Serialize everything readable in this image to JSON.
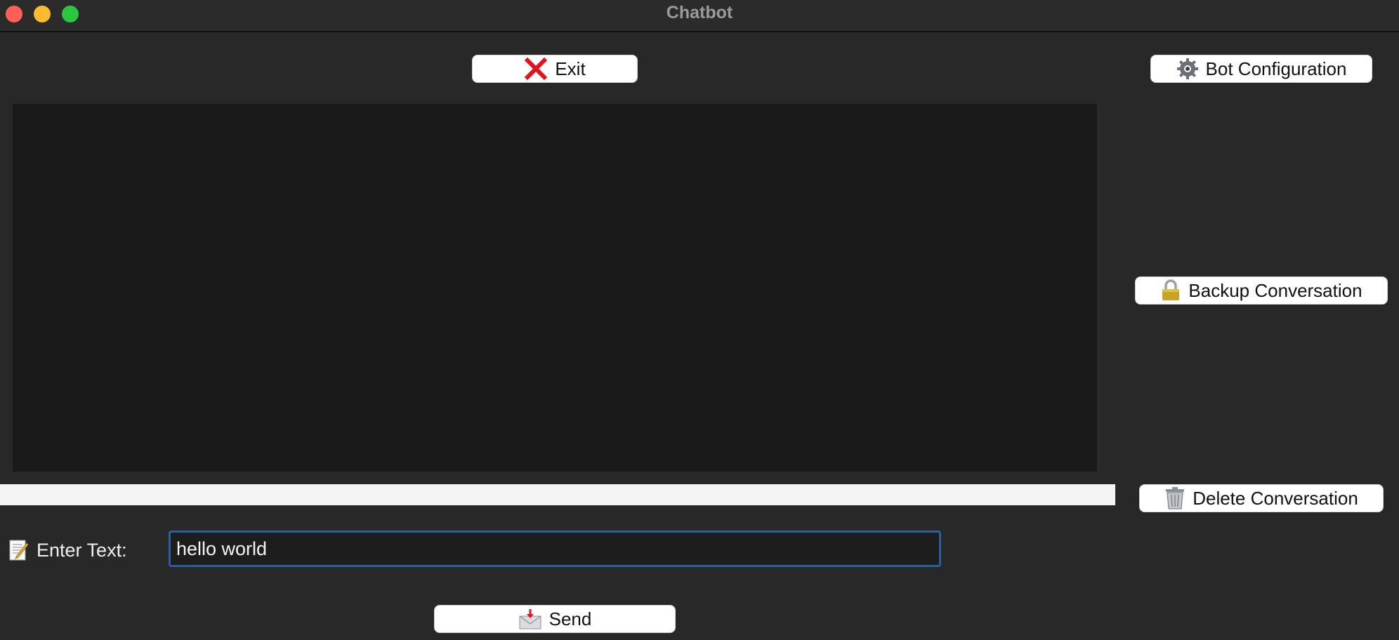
{
  "window": {
    "title": "Chatbot"
  },
  "toolbar": {
    "exit_label": "Exit",
    "bot_config_label": "Bot Configuration",
    "backup_label": "Backup Conversation",
    "delete_label": "Delete Conversation",
    "send_label": "Send"
  },
  "input": {
    "label": "Enter Text:",
    "value": "hello world"
  },
  "icons": {
    "exit": "close-x-icon",
    "bot_config": "gear-icon",
    "backup": "lock-icon",
    "delete": "trash-icon",
    "enter_text": "memo-icon",
    "send": "envelope-icon"
  },
  "colors": {
    "background": "#282828",
    "chat_area": "#1a1a1a",
    "input_border": "#2f5da3",
    "exit_icon": "#e0141e"
  }
}
